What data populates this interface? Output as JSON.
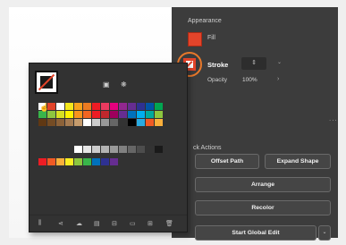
{
  "properties": {
    "appearance_title": "Appearance",
    "fill_label": "Fill",
    "fill_color": "#e2442a",
    "stroke_label": "Stroke",
    "stroke_color": "#e2442a",
    "stroke_value": "",
    "opacity_label": "Opacity",
    "opacity_value": "100%",
    "more_label": "...",
    "quick_actions_title": "ck Actions",
    "buttons": {
      "offset_path": "Offset Path",
      "expand_shape": "Expand Shape",
      "arrange": "Arrange",
      "recolor": "Recolor",
      "start_global_edit": "Start Global Edit"
    },
    "highlight_color": "#e8782a"
  },
  "swatches_panel": {
    "selected": "none",
    "palette": [
      "#ffffff",
      "#e2442a",
      "#ffffff",
      "#f4e71c",
      "#f7a21c",
      "#ec7b21",
      "#ed1c24",
      "#ea3a5f",
      "#e6007e",
      "#92278f",
      "#662d91",
      "#2e3192",
      "#0054a6",
      "#00a651",
      "#39b54a",
      "#8dc63f",
      "#d7df23",
      "#fff200",
      "#f7941d",
      "#f26522",
      "#ed1c24",
      "#c1272d",
      "#9e005d",
      "#662d91",
      "#0072bc",
      "#00aeef",
      "#00a99d",
      "#8cc63e",
      "#603813",
      "#754c24",
      "#8c6239",
      "#a67c52",
      "#c69c6d",
      "#ffffff",
      "#cccccc",
      "#999999",
      "#666666",
      "#333333",
      "#000000",
      "#29abe2",
      "#f15a24",
      "#fbb03b"
    ],
    "greys": [
      "#ffffff",
      "#e6e6e6",
      "#cccccc",
      "#b3b3b3",
      "#999999",
      "#808080",
      "#666666",
      "#4d4d4d",
      "#333333",
      "#1a1a1a"
    ],
    "group_swatches": [
      "#ed1c24",
      "#f15a24",
      "#fbb03b",
      "#fcee21",
      "#8cc63f",
      "#39b54a",
      "#0071bc",
      "#2e3192",
      "#662d91"
    ]
  }
}
